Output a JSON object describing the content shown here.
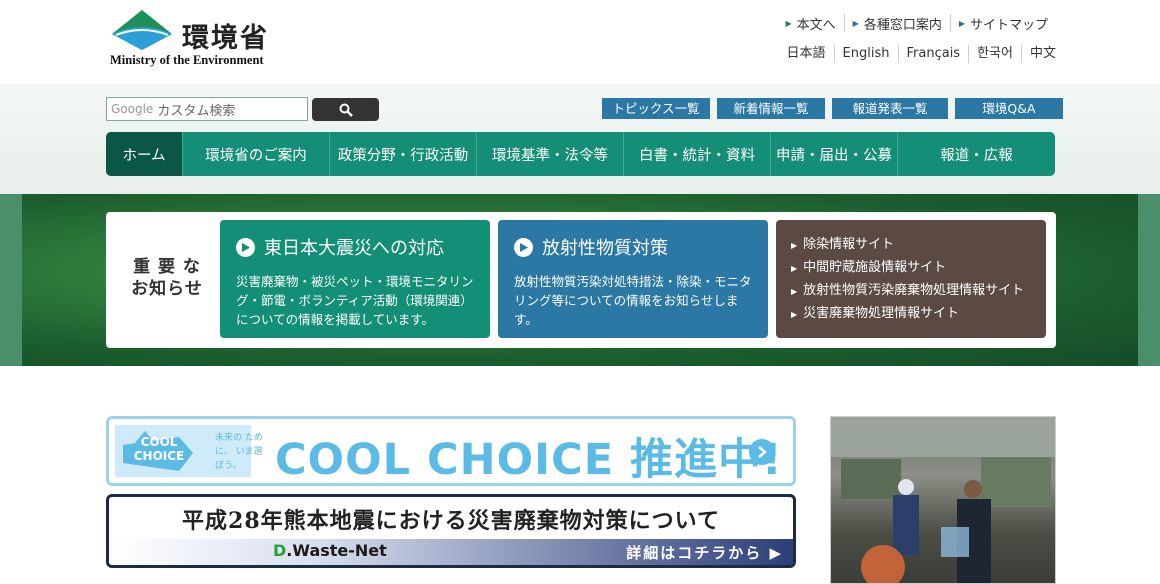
{
  "header": {
    "logo_jp": "環境省",
    "logo_en": "Ministry of the Environment",
    "util_links": [
      "本文へ",
      "各種窓口案内",
      "サイトマップ"
    ],
    "languages": [
      "日本語",
      "English",
      "Français",
      "한국어",
      "中文"
    ]
  },
  "search": {
    "brand": "Google",
    "placeholder": "カスタム検索"
  },
  "quick_links": [
    "トピックス一覧",
    "新着情報一覧",
    "報道発表一覧",
    "環境Q&A"
  ],
  "global_nav": [
    "ホーム",
    "環境省のご案内",
    "政策分野・行政活動",
    "環境基準・法令等",
    "白書・統計・資料",
    "申請・届出・公募",
    "報道・広報"
  ],
  "important": {
    "label_line1": "重 要 な",
    "label_line2": "お知らせ",
    "card1": {
      "title": "東日本大震災への対応",
      "text": "災害廃棄物・被災ペット・環境モニタリング・節電・ボランティア活動（環境関連）についての情報を掲載しています。"
    },
    "card2": {
      "title": "放射性物質対策",
      "text": "放射性物質汚染対処特措法・除染・モニタリング等についての情報をお知らせします。"
    },
    "links": [
      "除染情報サイト",
      "中間貯蔵施設情報サイト",
      "放射性物質汚染廃棄物処理情報サイト",
      "災害廃棄物処理情報サイト"
    ]
  },
  "banners": {
    "cool_logo_line1": "COOL",
    "cool_logo_line2": "CHOICE",
    "cool_small": "未来の ために、 いま選ぼう。",
    "cool_text": "COOL CHOICE 推進中!",
    "kumamoto_title": "平成28年熊本地震における災害廃棄物対策について",
    "dwaste_prefix": "D",
    "dwaste_name": ".Waste-Net",
    "kumamoto_more": "詳細はコチラから"
  },
  "colors": {
    "teal": "#138f77",
    "blue": "#2b78a4",
    "brown": "#5a4a43",
    "cool_blue": "#5bbbe5"
  }
}
